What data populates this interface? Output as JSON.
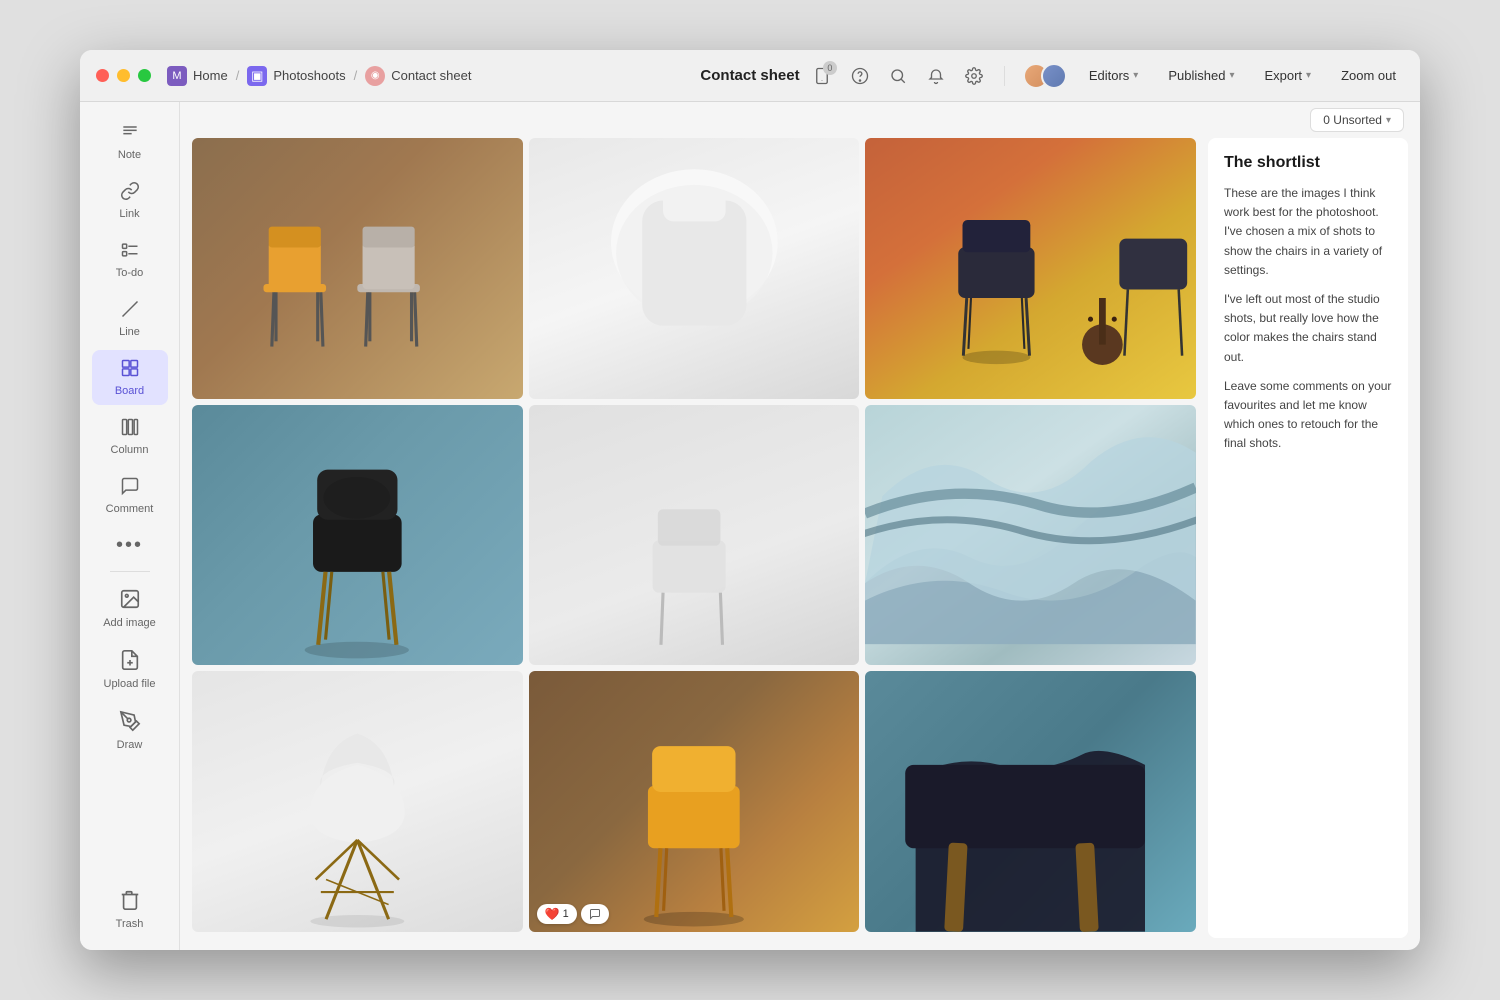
{
  "window": {
    "title": "Contact sheet"
  },
  "titlebar": {
    "breadcrumb": [
      {
        "label": "Home",
        "icon": "M",
        "iconType": "home"
      },
      {
        "label": "Photoshoots",
        "icon": "▣",
        "iconType": "photo"
      },
      {
        "label": "Contact sheet",
        "icon": "◉",
        "iconType": "contact"
      }
    ],
    "editors_label": "Editors",
    "published_label": "Published",
    "export_label": "Export",
    "zoom_label": "Zoom out"
  },
  "sidebar": {
    "items": [
      {
        "id": "note",
        "label": "Note",
        "icon": "≡"
      },
      {
        "id": "link",
        "label": "Link",
        "icon": "⛓"
      },
      {
        "id": "todo",
        "label": "To-do",
        "icon": "☑"
      },
      {
        "id": "line",
        "label": "Line",
        "icon": "╱"
      },
      {
        "id": "board",
        "label": "Board",
        "icon": "⊞",
        "active": true
      },
      {
        "id": "column",
        "label": "Column",
        "icon": "▥"
      },
      {
        "id": "comment",
        "label": "Comment",
        "icon": "≡"
      },
      {
        "id": "more",
        "label": "···",
        "icon": "•••"
      },
      {
        "id": "add-image",
        "label": "Add image",
        "icon": "🖼"
      },
      {
        "id": "upload",
        "label": "Upload file",
        "icon": "📄"
      },
      {
        "id": "draw",
        "label": "Draw",
        "icon": "✏"
      }
    ],
    "trash_label": "Trash"
  },
  "sort": {
    "label": "0 Unsorted"
  },
  "grid": {
    "cells": [
      {
        "id": 1,
        "bg": "warm-dark",
        "row": 1,
        "col": 1
      },
      {
        "id": 2,
        "bg": "white",
        "row": 1,
        "col": 2
      },
      {
        "id": 3,
        "bg": "orange-yellow",
        "row": 1,
        "col": 3
      },
      {
        "id": 4,
        "bg": "teal",
        "row": 1,
        "col": 4
      },
      {
        "id": 5,
        "bg": "light-grey",
        "row": 2,
        "col": 1
      },
      {
        "id": 6,
        "bg": "abstract",
        "row": 2,
        "col": 2
      },
      {
        "id": 7,
        "bg": "white2",
        "row": 2,
        "col": 3
      },
      {
        "id": 8,
        "bg": "dark-amber",
        "row": 2,
        "col": 4,
        "reaction": "❤️ 1",
        "comment": "💬"
      },
      {
        "id": 9,
        "bg": "teal-dark",
        "row": 3,
        "col": 1
      },
      {
        "id": 10,
        "bg": "light-warm",
        "row": 3,
        "col": 2
      },
      {
        "id": 11,
        "bg": "white-chair",
        "row": 3,
        "col": 3
      }
    ]
  },
  "side_panel": {
    "title": "The shortlist",
    "paragraphs": [
      "These are the images I think work best for the photoshoot. I've chosen a mix of shots to show the chairs in a variety of settings.",
      "I've left out most of the studio shots, but really love how the color makes the chairs stand out.",
      "Leave some comments on your favourites and let me know which ones to retouch for the final shots."
    ]
  },
  "colors": {
    "active_sidebar": "#e2e2ff",
    "active_icon": "#5a52d5",
    "accent": "#5a52d5"
  }
}
